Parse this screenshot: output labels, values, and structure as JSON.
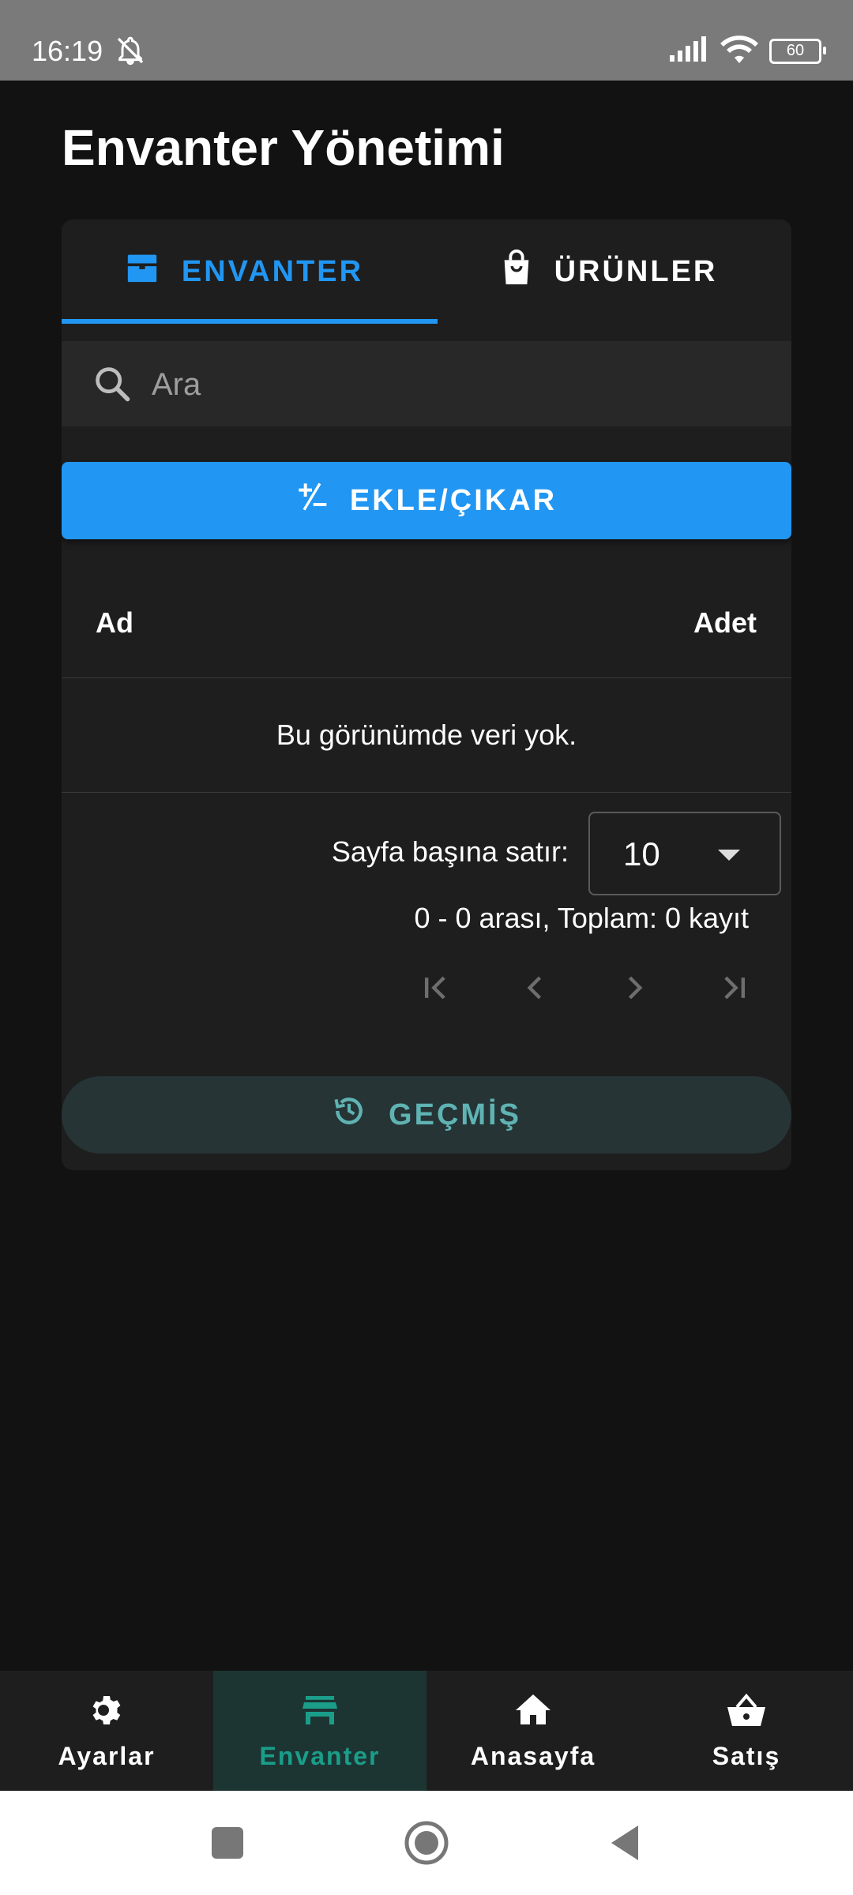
{
  "status_bar": {
    "time": "16:19",
    "battery": "60"
  },
  "page": {
    "title": "Envanter Yönetimi"
  },
  "tabs": [
    {
      "label": "ENVANTER",
      "icon": "inventory-box-icon",
      "active": true
    },
    {
      "label": "ÜRÜNLER",
      "icon": "shopping-bag-icon",
      "active": false
    }
  ],
  "search": {
    "placeholder": "Ara",
    "value": ""
  },
  "add_button": {
    "label": "EKLE/ÇIKAR",
    "icon": "plus-minus-icon"
  },
  "table": {
    "columns": [
      "Ad",
      "Adet"
    ],
    "empty_message": "Bu görünümde veri yok."
  },
  "pagination": {
    "rows_per_page_label": "Sayfa başına satır:",
    "rows_per_page_value": "10",
    "range_text": "0 - 0 arası, Toplam: 0 kayıt"
  },
  "history_button": {
    "label": "GEÇMİŞ",
    "icon": "history-icon"
  },
  "bottom_nav": [
    {
      "label": "Ayarlar",
      "icon": "gear-icon",
      "active": false
    },
    {
      "label": "Envanter",
      "icon": "store-icon",
      "active": true
    },
    {
      "label": "Anasayfa",
      "icon": "home-icon",
      "active": false
    },
    {
      "label": "Satış",
      "icon": "basket-icon",
      "active": false
    }
  ],
  "colors": {
    "primary": "#2196f3",
    "accent_teal": "#1a9e8a",
    "background": "#121212",
    "surface": "#1e1e1e"
  }
}
